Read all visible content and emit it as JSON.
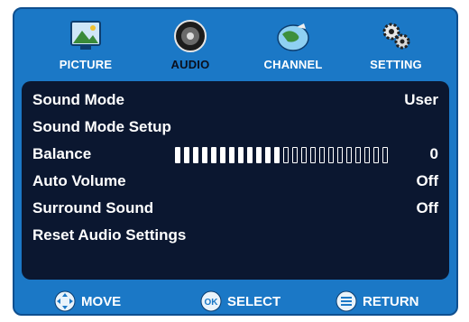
{
  "tabs": [
    {
      "label": "PICTURE",
      "icon": "picture-icon",
      "active": false
    },
    {
      "label": "AUDIO",
      "icon": "audio-speaker-icon",
      "active": true
    },
    {
      "label": "CHANNEL",
      "icon": "channel-globe-icon",
      "active": false
    },
    {
      "label": "SETTING",
      "icon": "gears-icon",
      "active": false
    }
  ],
  "menu": {
    "sound_mode": {
      "label": "Sound Mode",
      "value": "User"
    },
    "sound_mode_setup": {
      "label": "Sound Mode Setup"
    },
    "balance": {
      "label": "Balance",
      "value": "0",
      "bars_total": 24,
      "bars_filled": 12
    },
    "auto_volume": {
      "label": "Auto Volume",
      "value": "Off"
    },
    "surround_sound": {
      "label": "Surround Sound",
      "value": "Off"
    },
    "reset_audio": {
      "label": "Reset Audio Settings"
    }
  },
  "footer": {
    "move": "MOVE",
    "select": "SELECT",
    "select_icon_text": "OK",
    "return": "RETURN"
  },
  "colors": {
    "frame": "#1b78c6",
    "panel": "#0b1730",
    "text": "#ffffff"
  }
}
